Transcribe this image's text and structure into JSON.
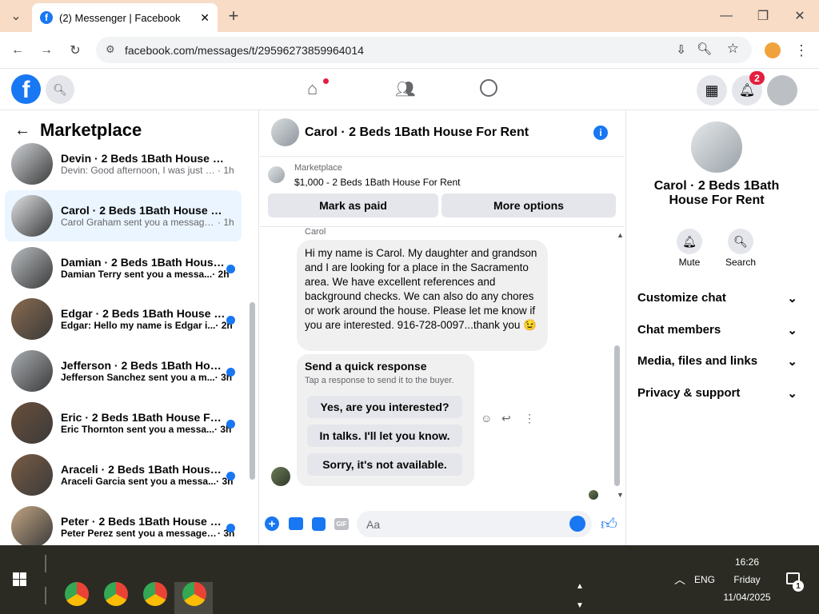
{
  "browser": {
    "tab_title": "(2) Messenger | Facebook",
    "url": "facebook.com/messages/t/29596273859964014"
  },
  "fb": {
    "notification_count": "2"
  },
  "left": {
    "title": "Marketplace",
    "conversations": [
      {
        "title": "Devin · 2 Beds 1Bath House For ...",
        "preview": "Devin: Good afternoon, I was just w...",
        "time": "· 1h",
        "selected": false,
        "unread": false
      },
      {
        "title": "Carol · 2 Beds 1Bath House For ...",
        "preview": "Carol Graham sent you a message ...",
        "time": "· 1h",
        "selected": true,
        "unread": false
      },
      {
        "title": "Damian · 2 Beds 1Bath House ...",
        "preview": "Damian Terry sent you a messa...",
        "time": "· 2h",
        "selected": false,
        "unread": true
      },
      {
        "title": "Edgar · 2 Beds 1Bath House Fo...",
        "preview": "Edgar: Hello my name is Edgar i...",
        "time": "· 2h",
        "selected": false,
        "unread": true
      },
      {
        "title": "Jefferson · 2 Beds 1Bath Hous...",
        "preview": "Jefferson Sanchez sent you a m...",
        "time": "· 3h",
        "selected": false,
        "unread": true
      },
      {
        "title": "Eric · 2 Beds 1Bath House For ...",
        "preview": "Eric Thornton sent you a messa...",
        "time": "· 3h",
        "selected": false,
        "unread": true
      },
      {
        "title": "Araceli · 2 Beds 1Bath House F...",
        "preview": "Araceli Garcia sent you a messa...",
        "time": "· 3h",
        "selected": false,
        "unread": true
      },
      {
        "title": "Peter · 2 Beds 1Bath House For...",
        "preview": "Peter Perez sent you a message ...",
        "time": "· 3h",
        "selected": false,
        "unread": true
      }
    ]
  },
  "chat": {
    "title": "Carol · 2 Beds 1Bath House For Rent",
    "listing_label": "Marketplace",
    "listing_detail": "$1,000 - 2 Beds 1Bath House For Rent",
    "mark_paid": "Mark as paid",
    "more_options": "More options",
    "sender": "Carol",
    "message": "Hi my name is Carol. My daughter and grandson and I are looking for a place in the Sacramento area. We have excellent references and background checks. We can also do any chores or work around the house. Please let me know if you are interested.  916-728-0097...thank you 😉",
    "quick_title": "Send a quick response",
    "quick_sub": "Tap a response to send it to the buyer.",
    "quick_replies": [
      "Yes, are you interested?",
      "In talks. I'll let you know.",
      "Sorry, it's not available."
    ],
    "composer_placeholder": "Aa"
  },
  "info": {
    "name": "Carol · 2 Beds 1Bath House For Rent",
    "mute": "Mute",
    "search": "Search",
    "sections": [
      "Customize chat",
      "Chat members",
      "Media, files and links",
      "Privacy & support"
    ]
  },
  "taskbar": {
    "time": "16:26",
    "day": "Friday",
    "date": "11/04/2025",
    "lang": "ENG",
    "notif_count": "1"
  },
  "colors": {
    "accent": "#1877f2",
    "selected_bg": "#ebf5ff",
    "taskbar": "#2b2b24",
    "tabstrip": "#f8dcc6"
  }
}
